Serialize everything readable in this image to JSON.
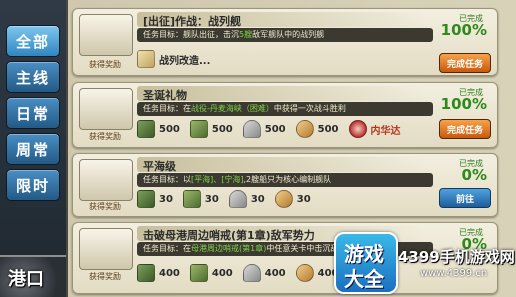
{
  "nav": {
    "tabs": [
      {
        "label": "全部"
      },
      {
        "label": "主线"
      },
      {
        "label": "日常"
      },
      {
        "label": "周常"
      },
      {
        "label": "限时"
      }
    ],
    "port_label": "港口"
  },
  "reward_label": "获得奖励",
  "goal_prefix": "任务目标：",
  "quests": [
    {
      "title": "[出征]作战：战列舰",
      "goal_a": "舰队出征，击沉",
      "goal_hl": "5艘",
      "goal_b": "敌军舰队中的战列舰",
      "status_label": "已完成",
      "percent": "100%",
      "button": "完成任务",
      "reward_text": "战列改造..."
    },
    {
      "title": "圣诞礼物",
      "goal_a": "在",
      "goal_hl": "战役-丹麦海峡（困难）",
      "goal_b": "中获得一次战斗胜利",
      "status_label": "已完成",
      "percent": "100%",
      "button": "完成任务",
      "rewards": [
        {
          "icon": "fuel-icon",
          "value": "500"
        },
        {
          "icon": "ammo-icon",
          "value": "500"
        },
        {
          "icon": "steel-icon",
          "value": "500"
        },
        {
          "icon": "bauxite-icon",
          "value": "500"
        }
      ],
      "ship_reward": "内华达"
    },
    {
      "title": "平海级",
      "goal_a": "以",
      "goal_hl": "[平海]、[宁海]",
      "goal_b": ",2艘船只为核心编制舰队",
      "status_label": "已完成",
      "percent": "0%",
      "button": "前往",
      "rewards": [
        {
          "icon": "fuel-icon",
          "value": "30"
        },
        {
          "icon": "ammo-icon",
          "value": "30"
        },
        {
          "icon": "steel-icon",
          "value": "30"
        },
        {
          "icon": "bauxite-icon",
          "value": "30"
        }
      ]
    },
    {
      "title": "击破母港周边哨戒(第1章)敌军势力",
      "goal_a": "在",
      "goal_hl": "母港周边哨戒(第1章)",
      "goal_b": "中任意关卡中击沉敌",
      "status_label": "已完成",
      "percent": "0%",
      "rewards": [
        {
          "icon": "fuel-icon",
          "value": "400"
        },
        {
          "icon": "ammo-icon",
          "value": "400"
        },
        {
          "icon": "steel-icon",
          "value": "400"
        },
        {
          "icon": "bauxite-icon",
          "value": "400"
        }
      ]
    }
  ],
  "watermark": {
    "logo_line1": "游戏",
    "logo_line2": "大全",
    "site": "4399手机游戏网",
    "url": "www.4399.cn"
  }
}
